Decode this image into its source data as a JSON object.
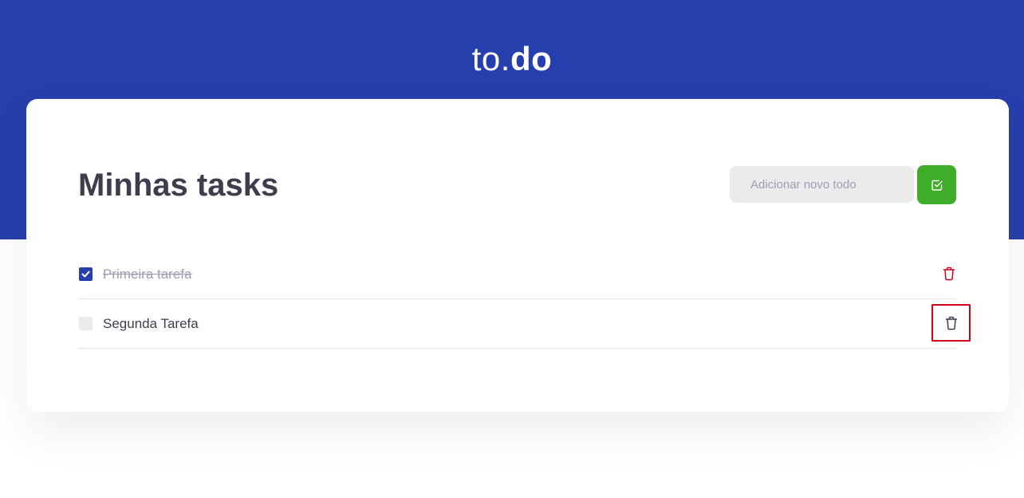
{
  "header": {
    "brand_light": "to.",
    "brand_bold": "do",
    "bg_color": "#273FAD"
  },
  "main": {
    "title": "Minhas tasks",
    "new_todo": {
      "placeholder": "Adicionar novo todo",
      "value": ""
    },
    "add_button_icon": "check-square-icon",
    "add_button_color": "#3FAD27"
  },
  "tasks": [
    {
      "label": "Primeira tarefa",
      "completed": true,
      "delete_icon": "trash-icon",
      "delete_color": "#D0021B"
    },
    {
      "label": "Segunda Tarefa",
      "completed": false,
      "delete_icon": "trash-icon",
      "delete_color": "#3D3D4D"
    }
  ]
}
